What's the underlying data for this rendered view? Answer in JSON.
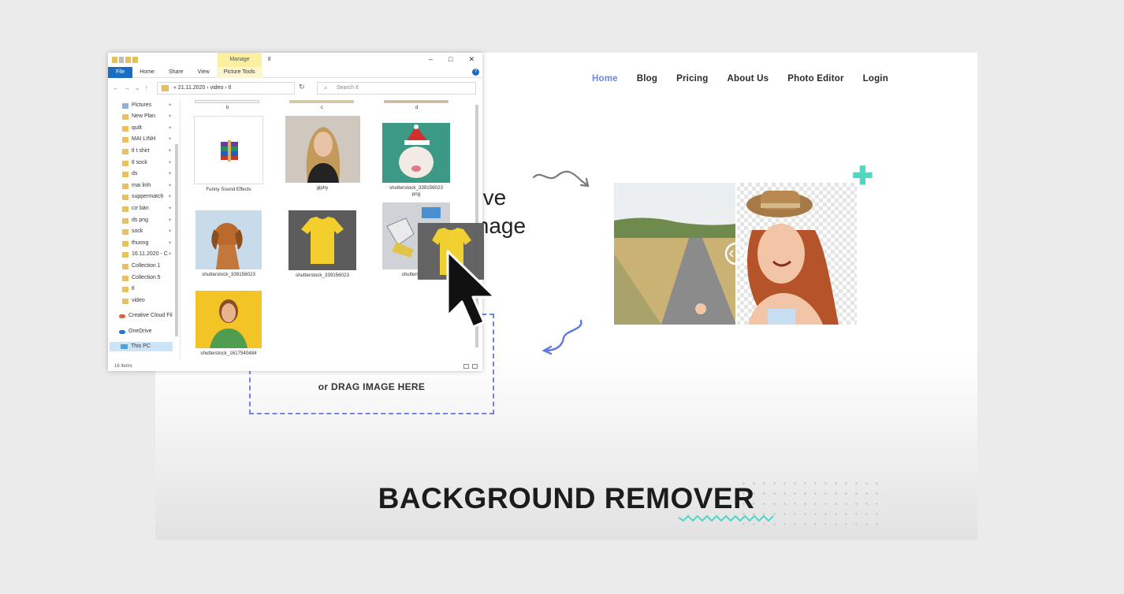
{
  "nav": {
    "items": [
      "Home",
      "Blog",
      "Pricing",
      "About Us",
      "Photo Editor",
      "Login"
    ],
    "active": "Home",
    "active_color": "#6b86e8"
  },
  "hero": {
    "line1": "ove",
    "line2": "mage"
  },
  "drop_zone": {
    "label": "or DRAG IMAGE HERE"
  },
  "page_title": "BACKGROUND REMOVER",
  "accent_color": "#4ed8c4",
  "explorer": {
    "manage_tab": "Manage",
    "window_title": "tl",
    "controls": {
      "minimize": "–",
      "maximize": "□",
      "close": "✕"
    },
    "ribbon_tabs": [
      "File",
      "Home",
      "Share",
      "View",
      "Picture Tools"
    ],
    "address_path": "« 21.11.2020  ›  video  ›  tl",
    "search_placeholder": "Search tl",
    "sidebar_items": [
      "Pictures",
      "New Plan",
      "quilt",
      "MAI LINH",
      "tl t shirt",
      "tl sock",
      "ds",
      "mai linh",
      "suppermatch",
      "cơ bản",
      "ds png",
      "sock",
      "thuong",
      "16.11.2020 - C",
      "Collection 1",
      "Collection 5",
      "tl",
      "video"
    ],
    "sidebar_extra": [
      "Creative Cloud Fil",
      "OneDrive",
      "This PC"
    ],
    "top_captions": [
      "b",
      "c",
      "d"
    ],
    "files": [
      {
        "name": "Funny Sound Effects",
        "icon": "winrar-archive-icon"
      },
      {
        "name": "giphy",
        "icon": "woman-portrait-thumb"
      },
      {
        "name": "shutterstock_339156023\npng",
        "icon": "bulldog-santa-hat-thumb"
      },
      {
        "name": "shutterstock_339156023",
        "icon": "golden-retriever-thumb"
      },
      {
        "name": "shutterstock_339156023",
        "icon": "yellow-tshirt-thumb"
      },
      {
        "name": "shutterstock_",
        "icon": "sneakers-thumb"
      },
      {
        "name": "shutterstock_1617540484",
        "icon": "woman-thinking-thumb"
      }
    ],
    "status": "16 items"
  }
}
